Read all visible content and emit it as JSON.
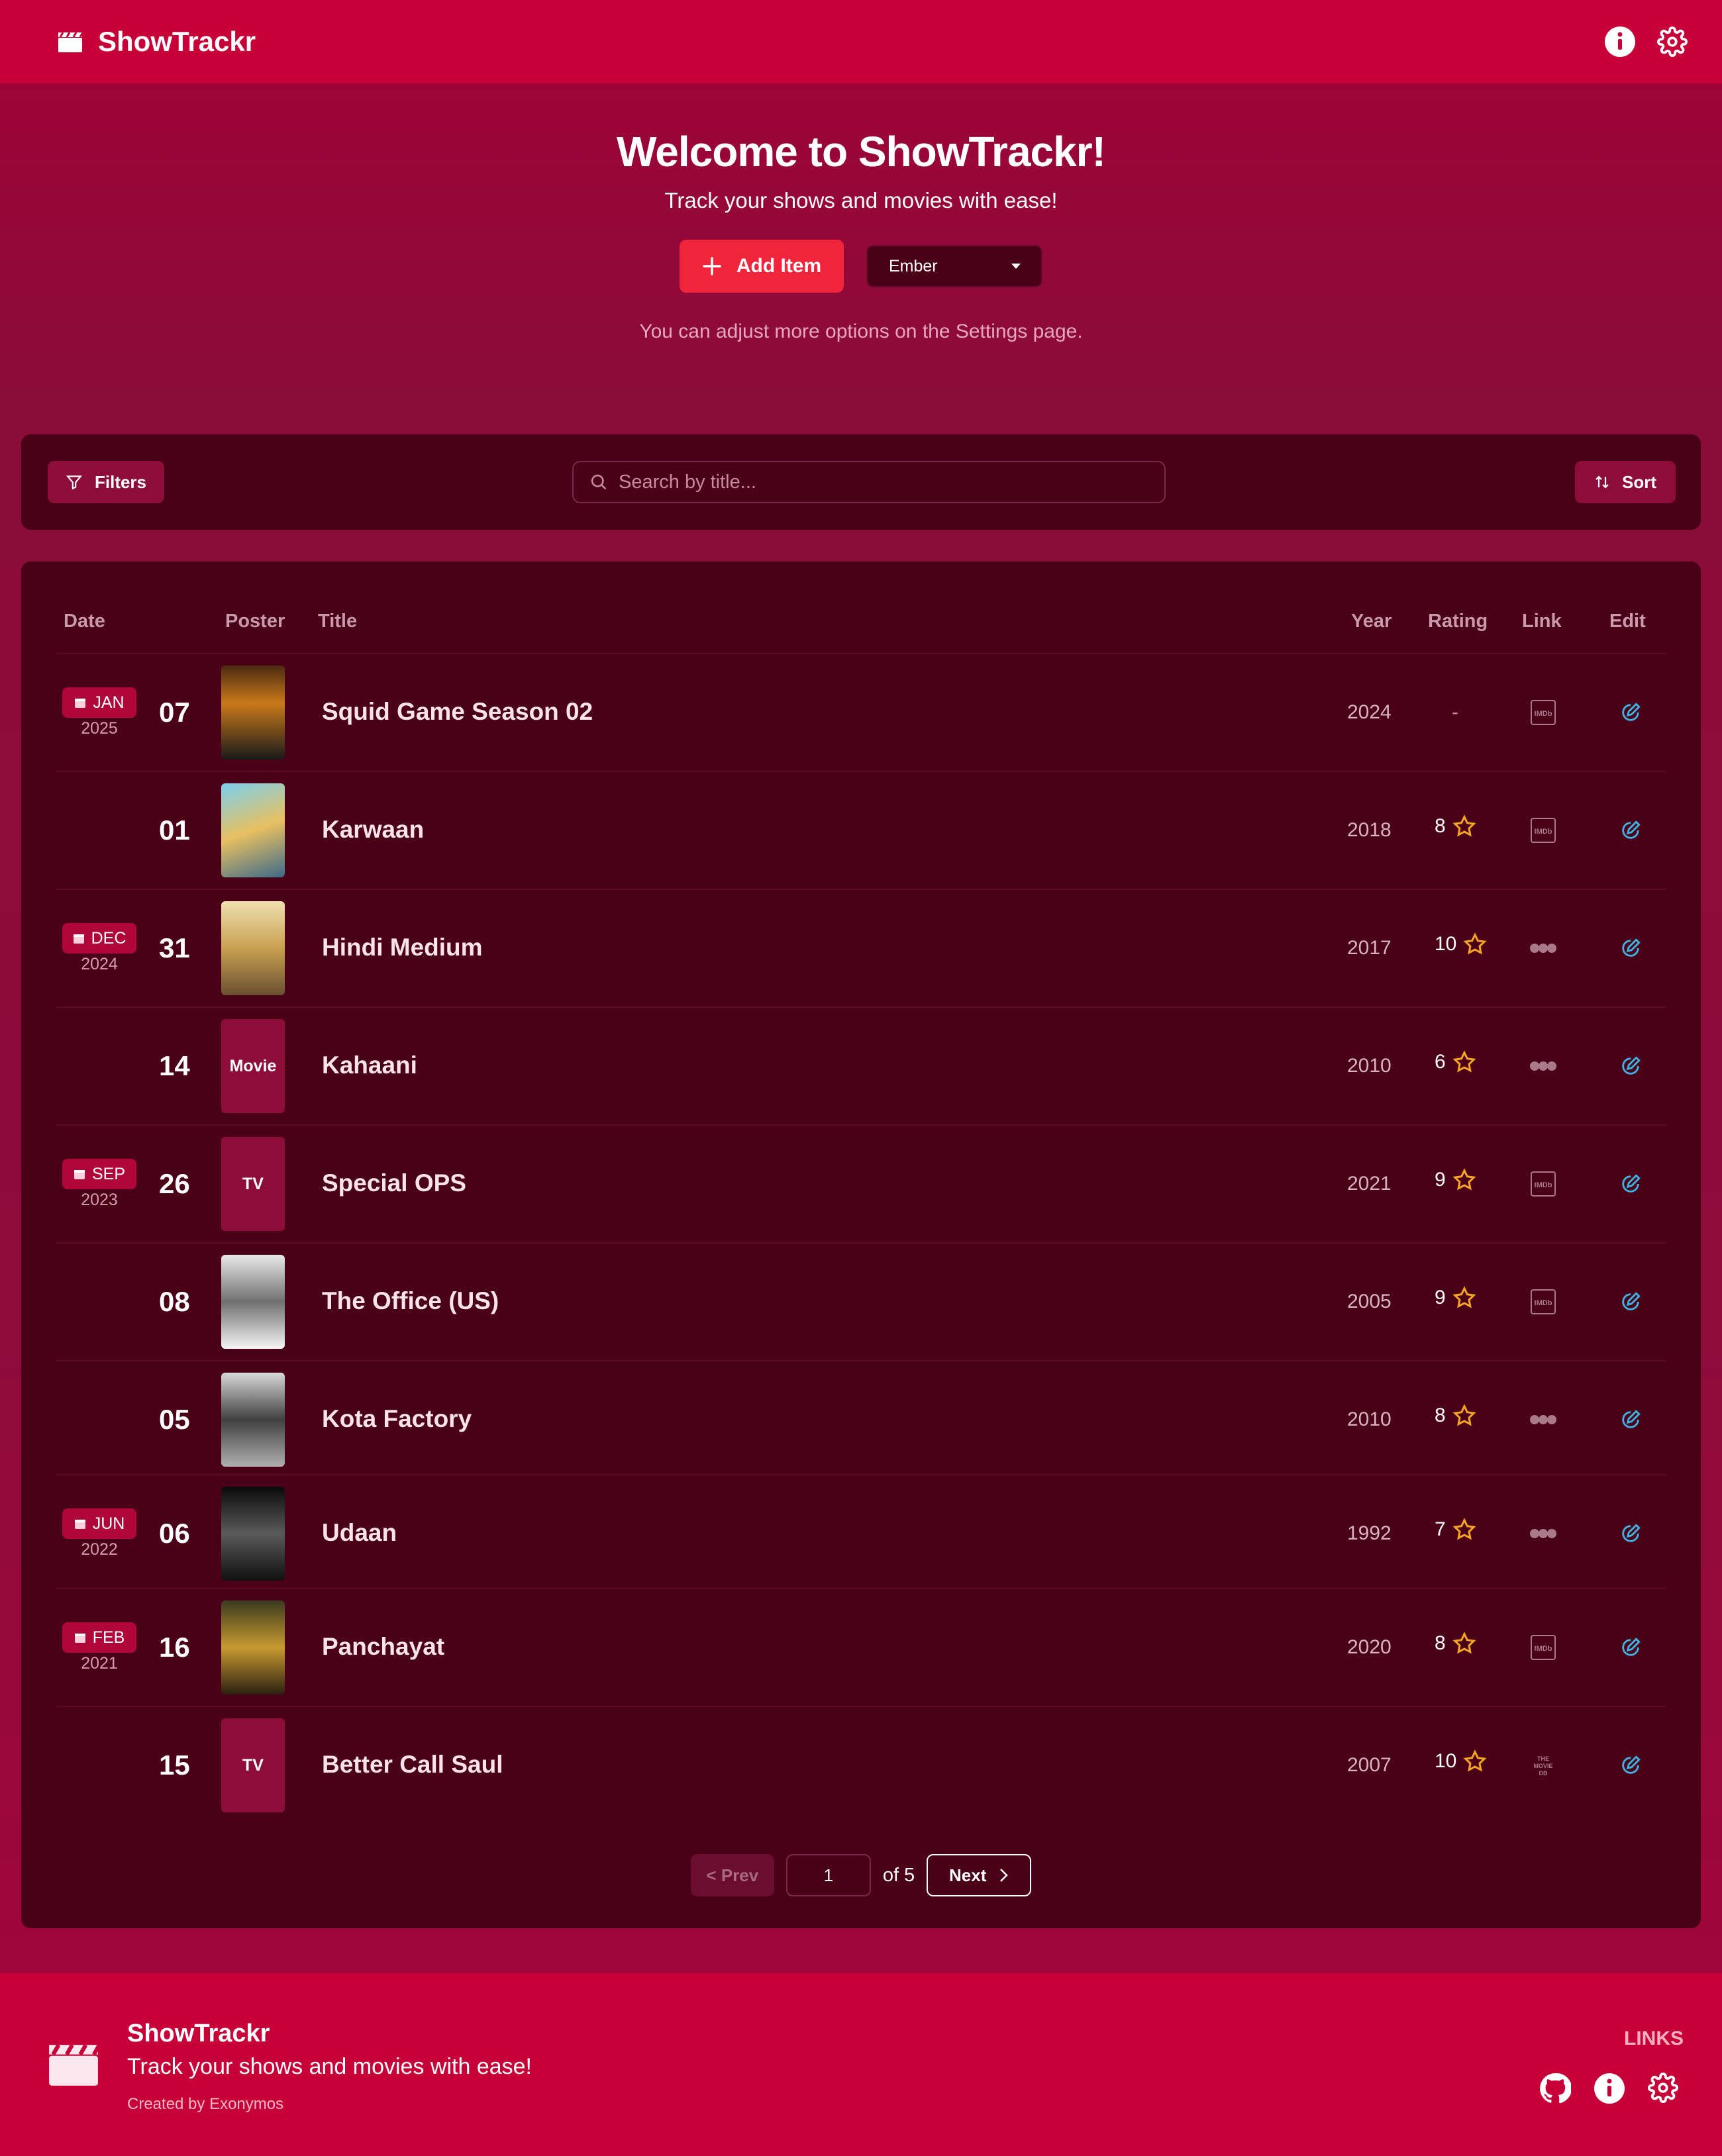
{
  "app": {
    "name": "ShowTrackr"
  },
  "hero": {
    "title": "Welcome to ShowTrackr!",
    "subtitle": "Track your shows and movies with ease!",
    "add_label": "Add Item",
    "theme_value": "Ember",
    "hint": "You can adjust more options on the Settings page."
  },
  "toolbar": {
    "filters_label": "Filters",
    "search_placeholder": "Search by title...",
    "sort_label": "Sort"
  },
  "table": {
    "headers": {
      "date": "Date",
      "poster": "Poster",
      "title": "Title",
      "year": "Year",
      "rating": "Rating",
      "link": "Link",
      "edit": "Edit"
    },
    "rows": [
      {
        "month": "JAN",
        "year_group": "2025",
        "day": "07",
        "poster_label": "",
        "title": "Squid Game Season 02",
        "year": "2024",
        "rating": "-",
        "link": "imdb-icon"
      },
      {
        "month": "",
        "year_group": "",
        "day": "01",
        "poster_label": "",
        "title": "Karwaan",
        "year": "2018",
        "rating": "8",
        "link": "imdb-icon"
      },
      {
        "month": "DEC",
        "year_group": "2024",
        "day": "31",
        "poster_label": "",
        "title": "Hindi Medium",
        "year": "2017",
        "rating": "10",
        "link": "letterboxd-icon"
      },
      {
        "month": "",
        "year_group": "",
        "day": "14",
        "poster_label": "Movie",
        "title": "Kahaani",
        "year": "2010",
        "rating": "6",
        "link": "letterboxd-icon"
      },
      {
        "month": "SEP",
        "year_group": "2023",
        "day": "26",
        "poster_label": "TV",
        "title": "Special OPS",
        "year": "2021",
        "rating": "9",
        "link": "imdb-icon"
      },
      {
        "month": "",
        "year_group": "",
        "day": "08",
        "poster_label": "",
        "title": "The Office (US)",
        "year": "2005",
        "rating": "9",
        "link": "imdb-icon"
      },
      {
        "month": "",
        "year_group": "",
        "day": "05",
        "poster_label": "",
        "title": "Kota Factory",
        "year": "2010",
        "rating": "8",
        "link": "letterboxd-icon"
      },
      {
        "month": "JUN",
        "year_group": "2022",
        "day": "06",
        "poster_label": "",
        "title": "Udaan",
        "year": "1992",
        "rating": "7",
        "link": "letterboxd-icon"
      },
      {
        "month": "FEB",
        "year_group": "2021",
        "day": "16",
        "poster_label": "",
        "title": "Panchayat",
        "year": "2020",
        "rating": "8",
        "link": "imdb-icon"
      },
      {
        "month": "",
        "year_group": "",
        "day": "15",
        "poster_label": "TV",
        "title": "Better Call Saul",
        "year": "2007",
        "rating": "10",
        "link": "tmdb-icon"
      }
    ]
  },
  "pager": {
    "prev": "< Prev",
    "page": "1",
    "of": "of 5",
    "next": "Next"
  },
  "footer": {
    "name": "ShowTrackr",
    "tagline": "Track your shows and movies with ease!",
    "credit": "Created by Exonymos",
    "links_label": "LINKS"
  },
  "colors": {
    "accent": "#c70037",
    "panel": "#4a0117",
    "star": "#f5a623",
    "edit": "#3cb4e6"
  }
}
